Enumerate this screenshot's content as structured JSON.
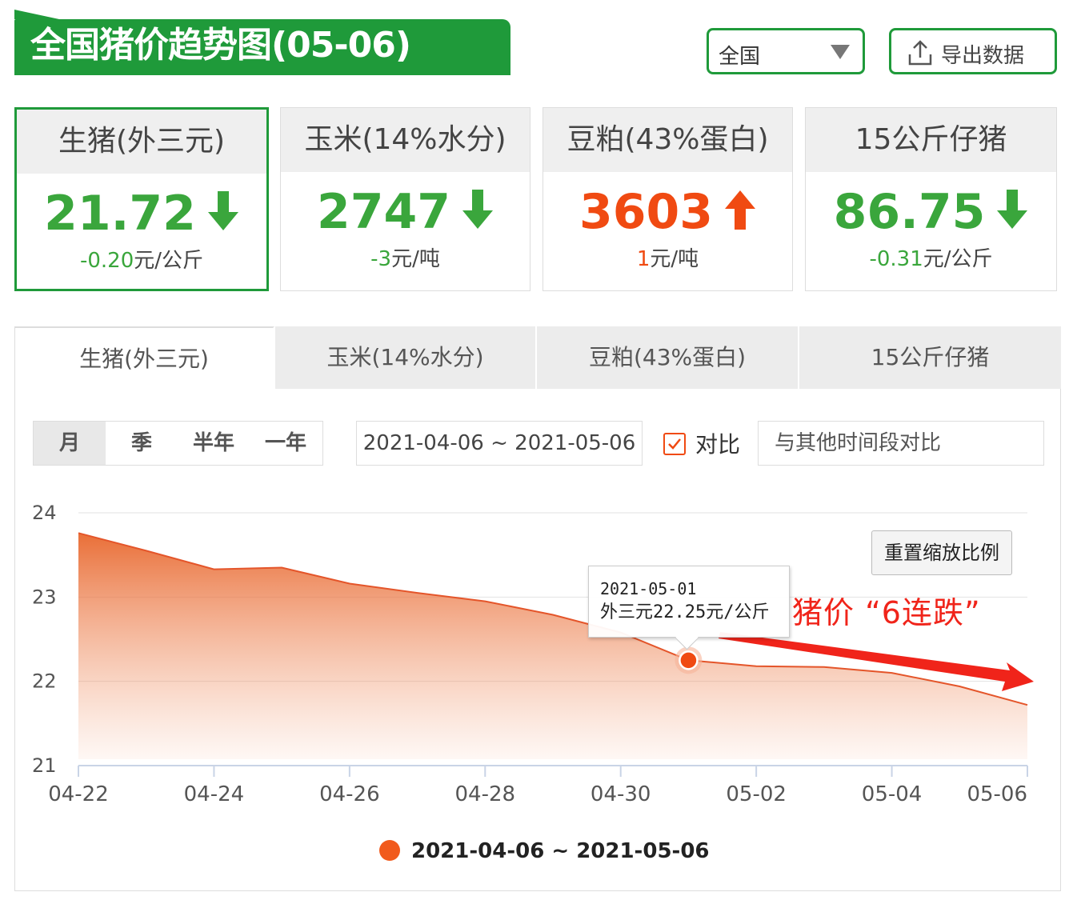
{
  "header": {
    "title": "全国猪价趋势图(05-06)",
    "region": "全国",
    "export_label": "导出数据"
  },
  "cards": [
    {
      "label": "生猪(外三元)",
      "value": "21.72",
      "change": "-0.20",
      "unit": "元/公斤",
      "trend": "down"
    },
    {
      "label": "玉米(14%水分)",
      "value": "2747",
      "change": "-3",
      "unit": "元/吨",
      "trend": "down"
    },
    {
      "label": "豆粕(43%蛋白)",
      "value": "3603",
      "change": "1",
      "unit": "元/吨",
      "trend": "up"
    },
    {
      "label": "15公斤仔猪",
      "value": "86.75",
      "change": "-0.31",
      "unit": "元/公斤",
      "trend": "down"
    }
  ],
  "tabs": [
    "生猪(外三元)",
    "玉米(14%水分)",
    "豆粕(43%蛋白)",
    "15公斤仔猪"
  ],
  "periods": [
    "月",
    "季",
    "半年",
    "一年"
  ],
  "date_range": "2021-04-06 ~ 2021-05-06",
  "compare": {
    "label": "对比",
    "placeholder": "与其他时间段对比"
  },
  "reset_label": "重置缩放比例",
  "tooltip": {
    "date": "2021-05-01",
    "value": "外三元22.25元/公斤"
  },
  "annotation": "猪价 “6连跌”",
  "colors": {
    "brand_green": "#1f9a3a",
    "up_red": "#f04a12",
    "down_green": "#3aa63c",
    "series": "#f15a1c"
  },
  "chart_data": {
    "type": "area",
    "title": "",
    "xlabel": "",
    "ylabel": "",
    "x": [
      "04-22",
      "04-23",
      "04-24",
      "04-25",
      "04-26",
      "04-27",
      "04-28",
      "04-29",
      "04-30",
      "05-01",
      "05-02",
      "05-03",
      "05-04",
      "05-05",
      "05-06"
    ],
    "x_ticks": [
      "04-22",
      "04-24",
      "04-26",
      "04-28",
      "04-30",
      "05-02",
      "05-04",
      "05-06"
    ],
    "ylim": [
      21,
      24
    ],
    "y_ticks": [
      21,
      22,
      23,
      24
    ],
    "grid": true,
    "legend": "bottom",
    "series": [
      {
        "name": "2021-04-06 ~ 2021-05-06",
        "values": [
          23.76,
          23.55,
          23.33,
          23.35,
          23.16,
          23.05,
          22.95,
          22.79,
          22.58,
          22.25,
          22.18,
          22.17,
          22.1,
          21.94,
          21.72
        ]
      }
    ],
    "highlight": {
      "x": "05-01",
      "y": 22.25
    }
  }
}
